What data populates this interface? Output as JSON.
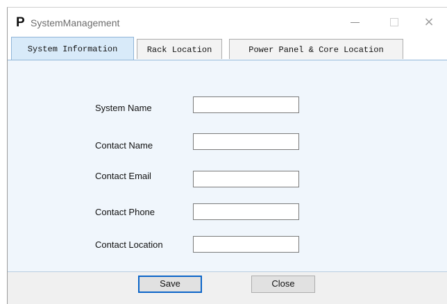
{
  "window": {
    "logo": "P",
    "title": "SystemManagement",
    "controls": {
      "minimize": "minimize-icon",
      "maximize": "maximize-icon",
      "close": "×"
    }
  },
  "tabs": [
    {
      "label": "System Information",
      "active": true
    },
    {
      "label": "Rack Location",
      "active": false
    },
    {
      "label": "Power Panel & Core Location",
      "active": false
    }
  ],
  "form": {
    "fields": [
      {
        "label": "System Name",
        "value": ""
      },
      {
        "label": "Contact Name",
        "value": ""
      },
      {
        "label": "Contact Email",
        "value": ""
      },
      {
        "label": "Contact Phone",
        "value": ""
      },
      {
        "label": "Contact Location",
        "value": ""
      }
    ]
  },
  "buttons": {
    "save_label": "Save",
    "close_label": "Close"
  },
  "colors": {
    "tab_active_bg": "#d8eaf9",
    "panel_bg": "#f0f6fc",
    "focus_border": "#0a64c8"
  }
}
